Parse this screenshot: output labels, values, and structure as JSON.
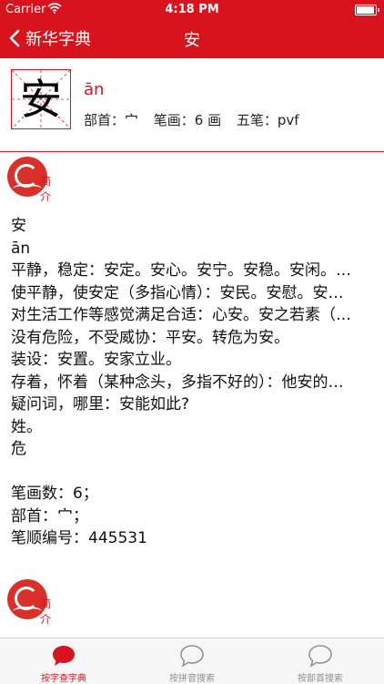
{
  "status_bar": {
    "carrier": "Carrier",
    "time": "4:18 PM"
  },
  "nav": {
    "back_label": "新华字典",
    "title": "安"
  },
  "character": {
    "glyph": "安",
    "pinyin": "ān",
    "radical_text": "部首：宀",
    "strokes_text": "笔画：6 画",
    "wubi_text": "五笔：pvf"
  },
  "section_label": "简介",
  "definition_lines": [
    "安",
    "ān",
    "平静，稳定：安定。安心。安宁。安稳。安闲。…",
    "使平静，使安定（多指心情）：安民。安慰。安…",
    "对生活工作等感觉满足合适：心安。安之若素（…",
    "没有危险，不受威协：平安。转危为安。",
    "装设：安置。安家立业。",
    "存着，怀着（某种念头，多指不好的）：他安的…",
    "疑问词，哪里：安能如此?",
    "姓。",
    "危"
  ],
  "stats_lines": [
    "笔画数：6；",
    "部首：宀；",
    "笔顺编号：445531"
  ],
  "tabs": [
    {
      "label": "按字查字典",
      "active": true
    },
    {
      "label": "按拼音搜索",
      "active": false
    },
    {
      "label": "按部首搜索",
      "active": false
    }
  ],
  "colors": {
    "accent": "#d7141e",
    "tab_inactive": "#8e8e93"
  }
}
